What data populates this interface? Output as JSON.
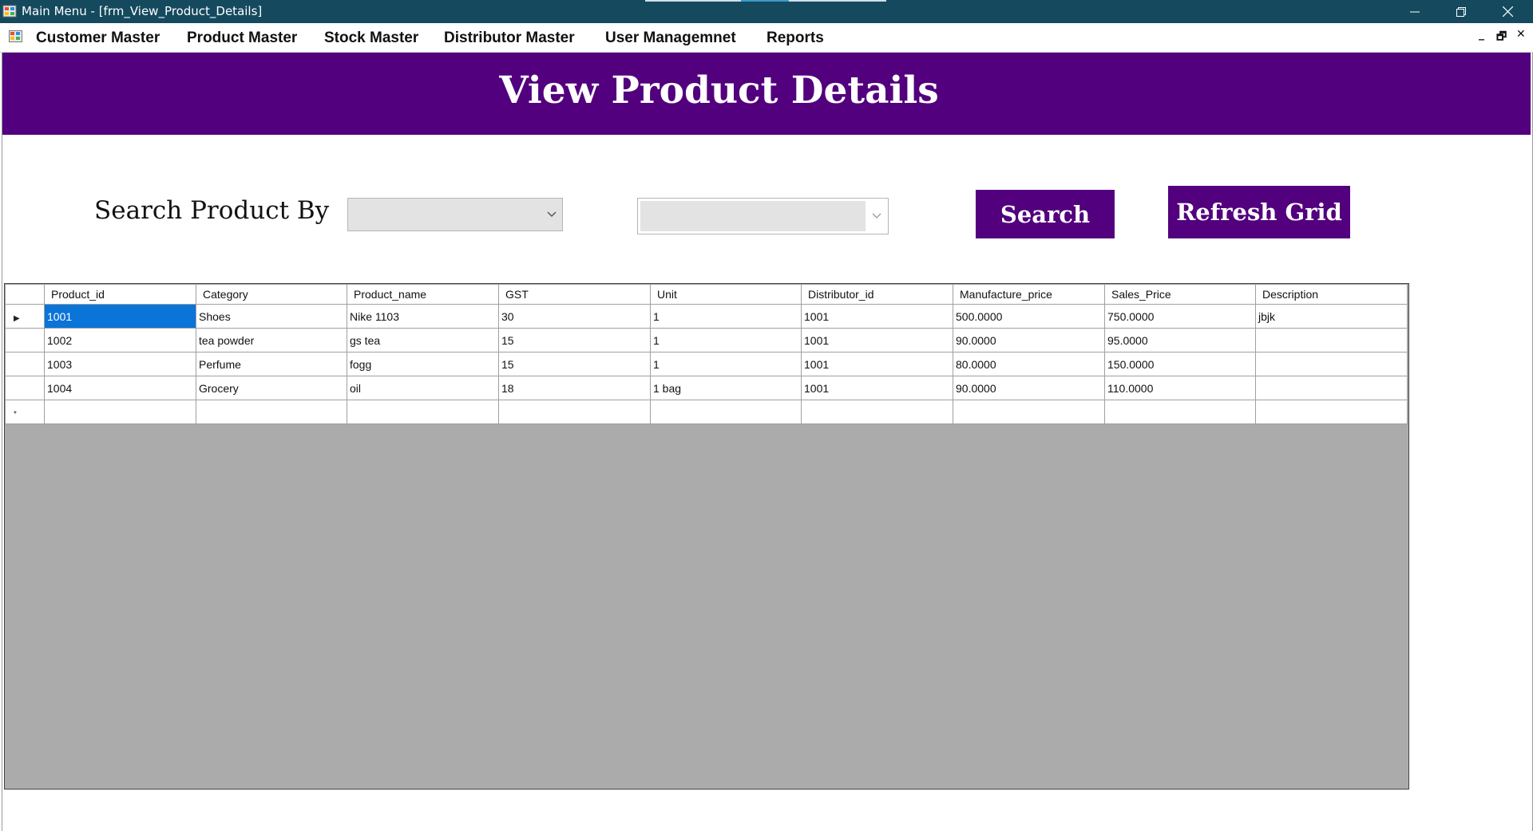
{
  "window": {
    "title": "Main Menu - [frm_View_Product_Details]",
    "minimize_glyph": "—",
    "maximize_glyph": "❐",
    "close_glyph": "✕"
  },
  "menu": {
    "items": [
      "Customer Master",
      "Product Master",
      "Stock Master",
      "Distributor Master",
      "User Managemnet",
      "Reports"
    ],
    "mdi_minimize": "_",
    "mdi_restore": "🗗",
    "mdi_close": "✕"
  },
  "form": {
    "heading": "View Product Details",
    "search_label": "Search Product By",
    "search_by_value": "",
    "search_value": "",
    "search_button": "Search",
    "refresh_button": "Refresh Grid"
  },
  "grid": {
    "columns": [
      "Product_id",
      "Category",
      "Product_name",
      "GST",
      "Unit",
      "Distributor_id",
      "Manufacture_price",
      "Sales_Price",
      "Description"
    ],
    "rows": [
      [
        "1001",
        "Shoes",
        "Nike 1103",
        "30",
        "1",
        "1001",
        "500.0000",
        "750.0000",
        "jbjk"
      ],
      [
        "1002",
        "tea powder",
        "gs tea",
        "15",
        "1",
        "1001",
        "90.0000",
        "95.0000",
        ""
      ],
      [
        "1003",
        "Perfume",
        "fogg",
        "15",
        "1",
        "1001",
        "80.0000",
        "150.0000",
        ""
      ],
      [
        "1004",
        "Grocery",
        "oil",
        "18",
        "1 bag",
        "1001",
        "90.0000",
        "110.0000",
        ""
      ]
    ],
    "current_row_marker": "▶",
    "new_row_marker": "*"
  },
  "colors": {
    "titlebar": "#154a5e",
    "brand_purple": "#52007d",
    "selection": "#0a74d9",
    "grid_background": "#ababab"
  }
}
